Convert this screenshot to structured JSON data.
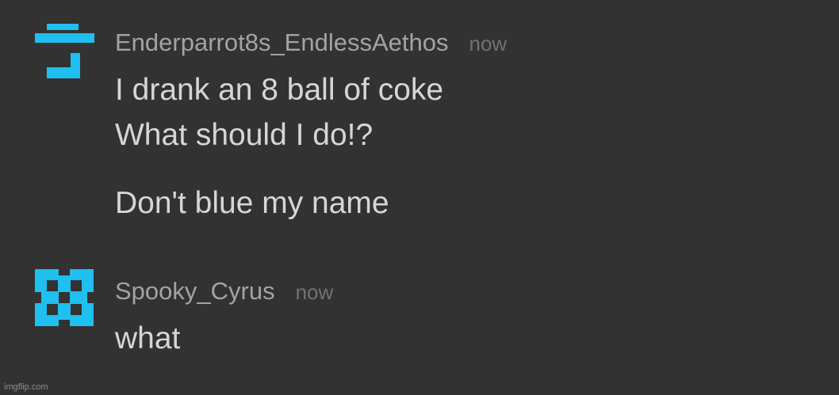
{
  "comments": [
    {
      "username": "Enderparrot8s_EndlessAethos",
      "timestamp": "now",
      "lines": [
        "I drank an 8 ball of coke",
        "What should I do!?",
        "Don't blue my name"
      ],
      "avatar_color": "#1fbff0"
    },
    {
      "username": "Spooky_Cyrus",
      "timestamp": "now",
      "lines": [
        "what"
      ],
      "avatar_color": "#1fbff0"
    }
  ],
  "watermark": "imgflip.com",
  "colors": {
    "background": "#323232",
    "username": "#a3a3a3",
    "timestamp": "#727272",
    "text": "#d6d6d6",
    "accent": "#1fbff0"
  }
}
